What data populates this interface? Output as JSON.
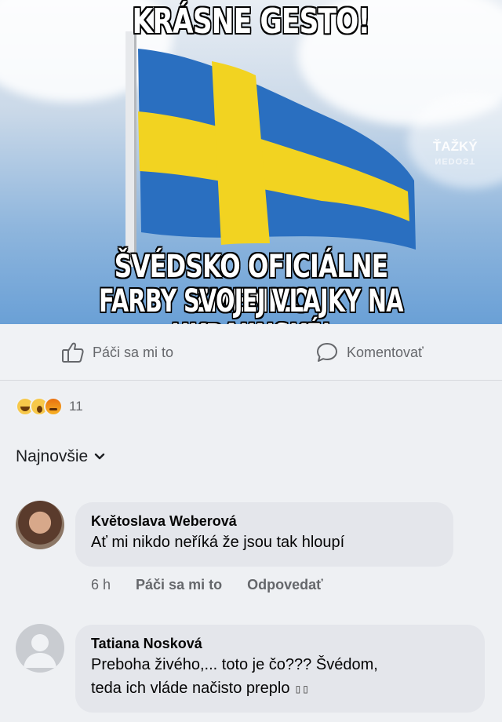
{
  "meme": {
    "top_text": "KRÁSNE GESTO!",
    "bottom_line1": "ŠVÉDSKO OFICIÁLNE ZMENILO",
    "bottom_line2": "FARBY SVOJEJ VLAJKY NA UKRAJINSKÉ!",
    "watermark": "ŤAŽKÝ",
    "watermark_sub": "NEDOST",
    "flag_blue": "#2a6fc0",
    "flag_yellow": "#f2d321"
  },
  "actions": {
    "like_label": "Páči sa mi to",
    "comment_label": "Komentovať"
  },
  "reactions": {
    "icons": [
      "haha-icon",
      "wow-icon",
      "angry-icon"
    ],
    "count": "11"
  },
  "sort": {
    "label": "Najnovšie"
  },
  "comments": [
    {
      "author": "Květoslava Weberová",
      "text": "Ať mi  nikdo neříká  že jsou tak  hloupí",
      "time": "6 h",
      "like_label": "Páči sa mi to",
      "reply_label": "Odpovedať"
    },
    {
      "author": "Tatiana Nosková",
      "text_line1": "Preboha živého,... toto je čo??? Švédom,",
      "text_line2": "teda ich vláde načisto preplo",
      "trailing_icons": "▯▯"
    }
  ]
}
